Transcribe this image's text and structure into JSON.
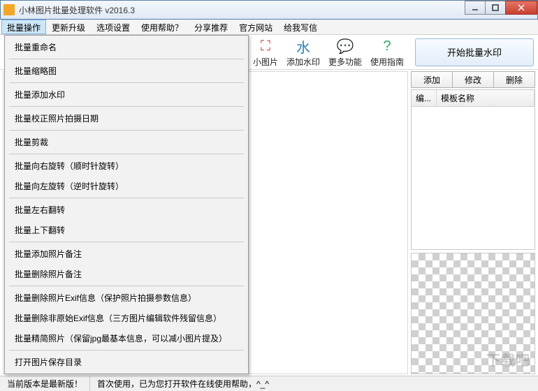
{
  "window": {
    "title": "小林图片批量处理软件 v2016.3"
  },
  "menubar": {
    "items": [
      "批量操作",
      "更新升级",
      "选项设置",
      "使用帮助？",
      "分享推荐",
      "官方网站",
      "给我写信"
    ],
    "active_index": 0
  },
  "dropdown": {
    "groups": [
      [
        "批量重命名"
      ],
      [
        "批量缩略图"
      ],
      [
        "批量添加水印"
      ],
      [
        "批量校正照片拍摄日期"
      ],
      [
        "批量剪裁"
      ],
      [
        "批量向右旋转（顺时针旋转）",
        "批量向左旋转（逆时针旋转）"
      ],
      [
        "批量左右翻转",
        "批量上下翻转"
      ],
      [
        "批量添加照片备注",
        "批量删除照片备注"
      ],
      [
        "批量删除照片Exif信息（保护照片拍摄参数信息）",
        "批量删除非原始Exif信息（三方图片编辑软件残留信息）",
        "批量精简照片（保留jpg最基本信息，可以减小图片提及）"
      ],
      [
        "打开图片保存目录"
      ]
    ]
  },
  "toolbar": {
    "buttons": [
      {
        "icon": "⛶",
        "label": "小图片",
        "color": "#c0392b"
      },
      {
        "icon": "水",
        "label": "添加水印",
        "color": "#2980b9"
      },
      {
        "icon": "💬",
        "label": "更多功能",
        "color": "#2c6fbb"
      },
      {
        "icon": "?",
        "label": "使用指南",
        "color": "#27ae60"
      }
    ],
    "primary_button": "开始批量水印"
  },
  "right": {
    "btns": [
      "添加",
      "修改",
      "删除"
    ],
    "cols": [
      "编...",
      "模板名称"
    ]
  },
  "status": {
    "left": "当前版本是最新版！",
    "right": "首次使用，已为您打开软件在线使用帮助，^_^"
  },
  "watermark": "下载吧"
}
